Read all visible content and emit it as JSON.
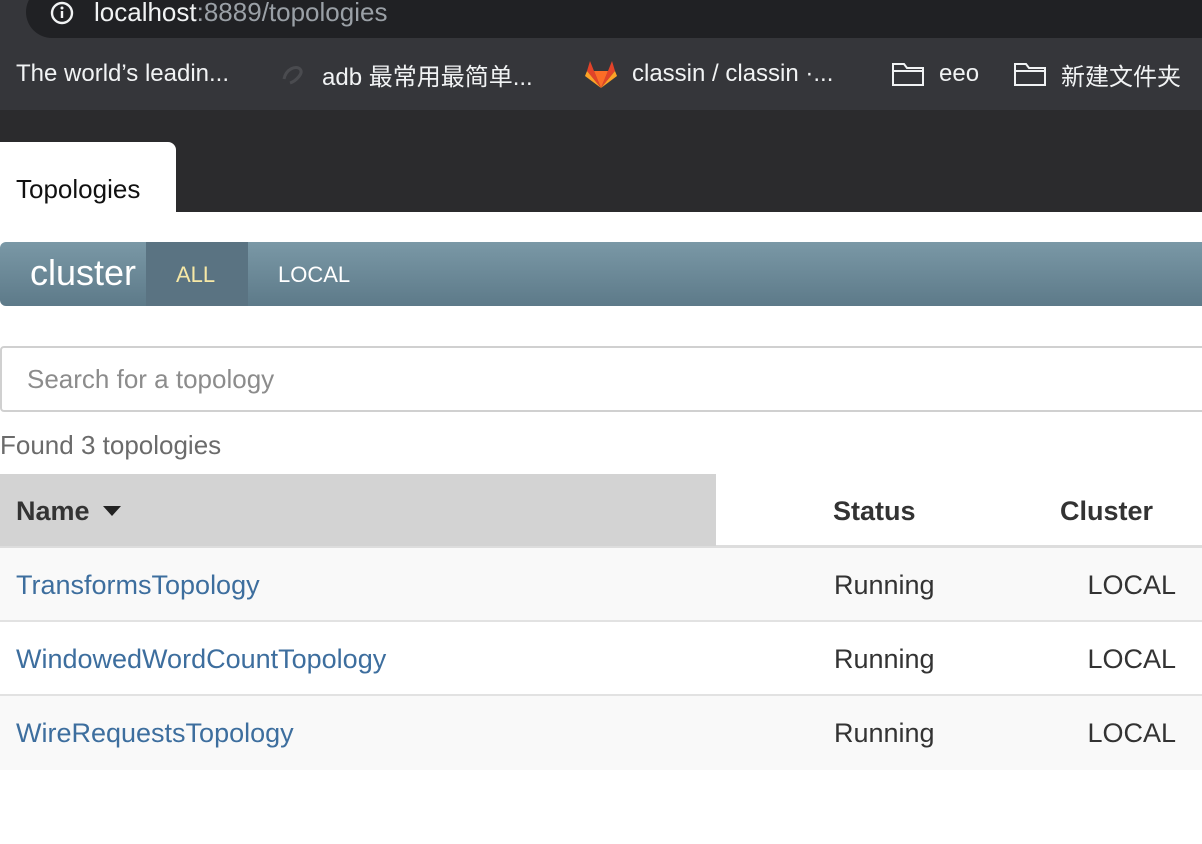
{
  "browser": {
    "url_host": "localhost",
    "url_rest": ":8889/topologies",
    "bookmarks": [
      {
        "label": "The world’s leadin...",
        "icon": "none"
      },
      {
        "label": "adb 最常用最简单...",
        "icon": "page-icon"
      },
      {
        "label": "classin / classin ·...",
        "icon": "gitlab-icon"
      },
      {
        "label": "eeo",
        "icon": "folder-icon"
      },
      {
        "label": "新建文件夹",
        "icon": "folder-icon"
      }
    ]
  },
  "tab": {
    "label": "Topologies"
  },
  "cluster_bar": {
    "title": "cluster",
    "filters": [
      {
        "label": "ALL",
        "selected": true
      },
      {
        "label": "LOCAL",
        "selected": false
      }
    ]
  },
  "search": {
    "placeholder": "Search for a topology",
    "value": ""
  },
  "found_text": "Found 3 topologies",
  "table": {
    "headers": {
      "name": "Name",
      "status": "Status",
      "cluster": "Cluster"
    },
    "sort": {
      "column": "Name",
      "direction": "desc-caret"
    },
    "rows": [
      {
        "name": "TransformsTopology",
        "status": "Running",
        "cluster": "LOCAL"
      },
      {
        "name": "WindowedWordCountTopology",
        "status": "Running",
        "cluster": "LOCAL"
      },
      {
        "name": "WireRequestsTopology",
        "status": "Running",
        "cluster": "LOCAL"
      }
    ]
  },
  "colors": {
    "link": "#3d6e9e",
    "cluster_bar": "#6a8795",
    "selected_filter_text": "#f6e8a6",
    "header_dark": "#2b2b2d"
  }
}
